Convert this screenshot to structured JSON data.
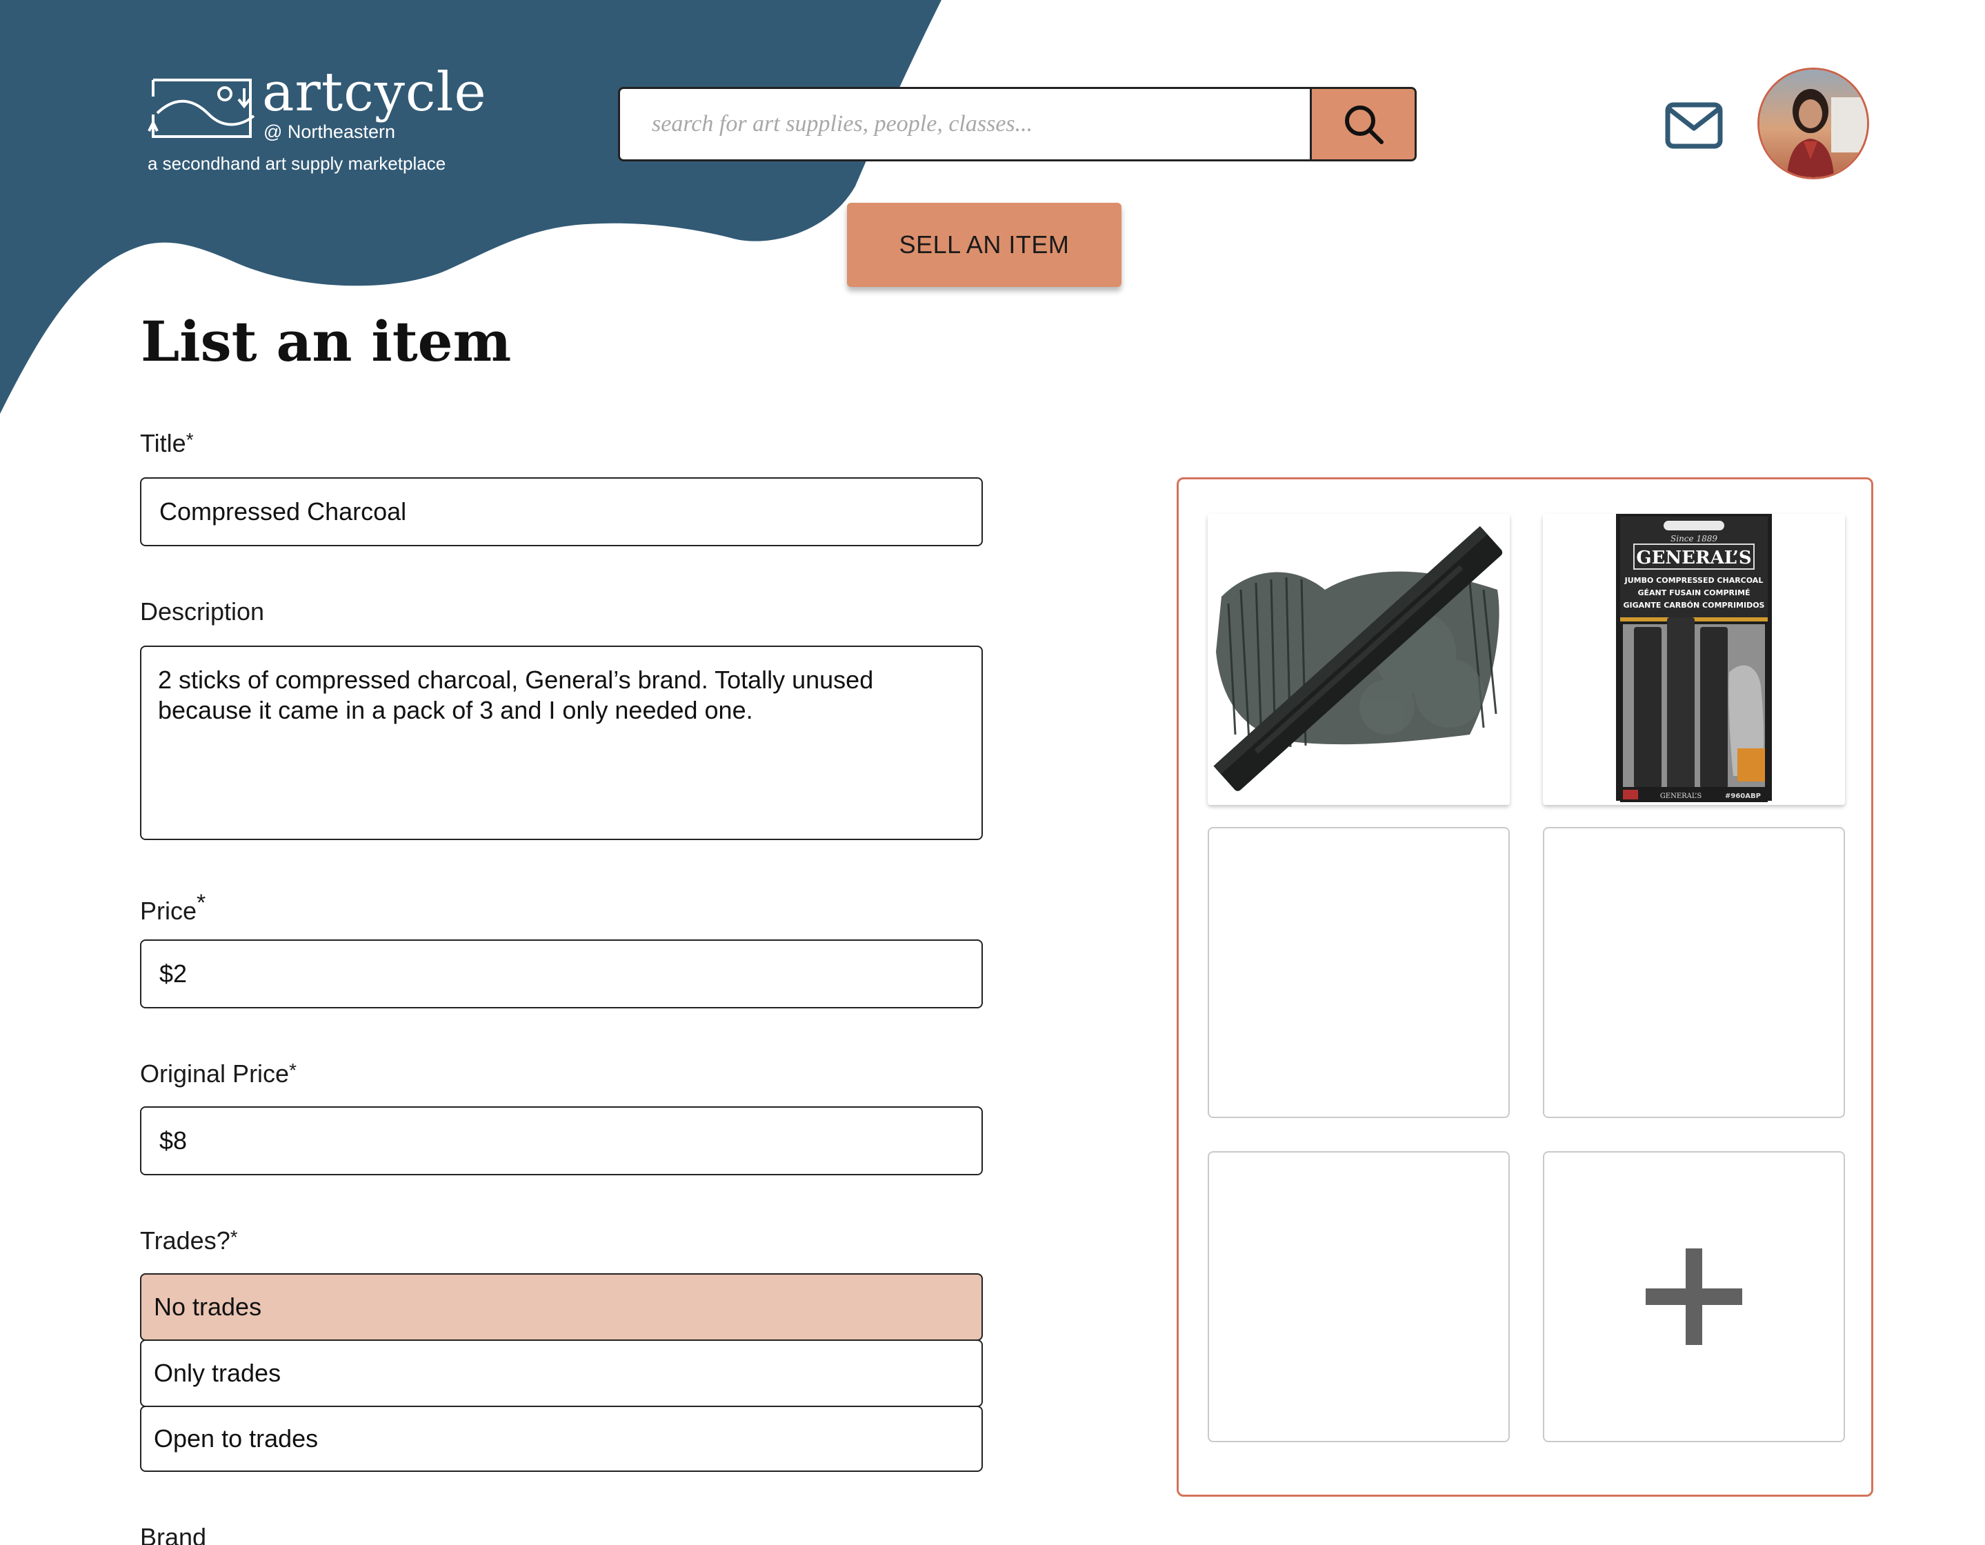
{
  "brand": {
    "name": "artcycle",
    "school": "@ Northeastern",
    "tagline": "a secondhand art supply marketplace",
    "accent_color": "#dc8f6c",
    "header_color": "#325a75"
  },
  "search": {
    "placeholder": "search for art supplies, people, classes...",
    "button_icon": "search-icon"
  },
  "nav": {
    "mail_icon": "mail-icon",
    "avatar_icon": "avatar"
  },
  "sell_button": "SELL AN ITEM",
  "page_title": "List an item",
  "form": {
    "title": {
      "label": "Title",
      "required": "*",
      "value": "Compressed Charcoal"
    },
    "description": {
      "label": "Description",
      "value": "2 sticks of compressed charcoal, General’s brand. Totally unused because it came in a pack of 3 and I only needed one."
    },
    "price": {
      "label": "Price",
      "required": "*",
      "value": "$2"
    },
    "original_price": {
      "label": "Original Price",
      "required": "*",
      "value": "$8"
    },
    "trades": {
      "label": "Trades?",
      "required": "*",
      "options": [
        "No trades",
        "Only trades",
        "Open to trades"
      ],
      "selected": "No trades"
    },
    "brand": {
      "label": "Brand"
    }
  },
  "photos": {
    "slots": [
      "charcoal stick photo",
      "General’s charcoal package photo",
      "empty",
      "empty",
      "empty",
      "add"
    ],
    "package_text": {
      "since": "Since 1889",
      "brand": "GENERAL’S",
      "line1": "JUMBO COMPRESSED CHARCOAL",
      "line2": "GÉANT FUSAIN COMPRIMÉ",
      "line3": "GIGANTE CARBÓN COMPRIMIDOS",
      "footer": "GENERAL’S",
      "sku": "#960ABP"
    },
    "add_icon": "plus-icon"
  }
}
